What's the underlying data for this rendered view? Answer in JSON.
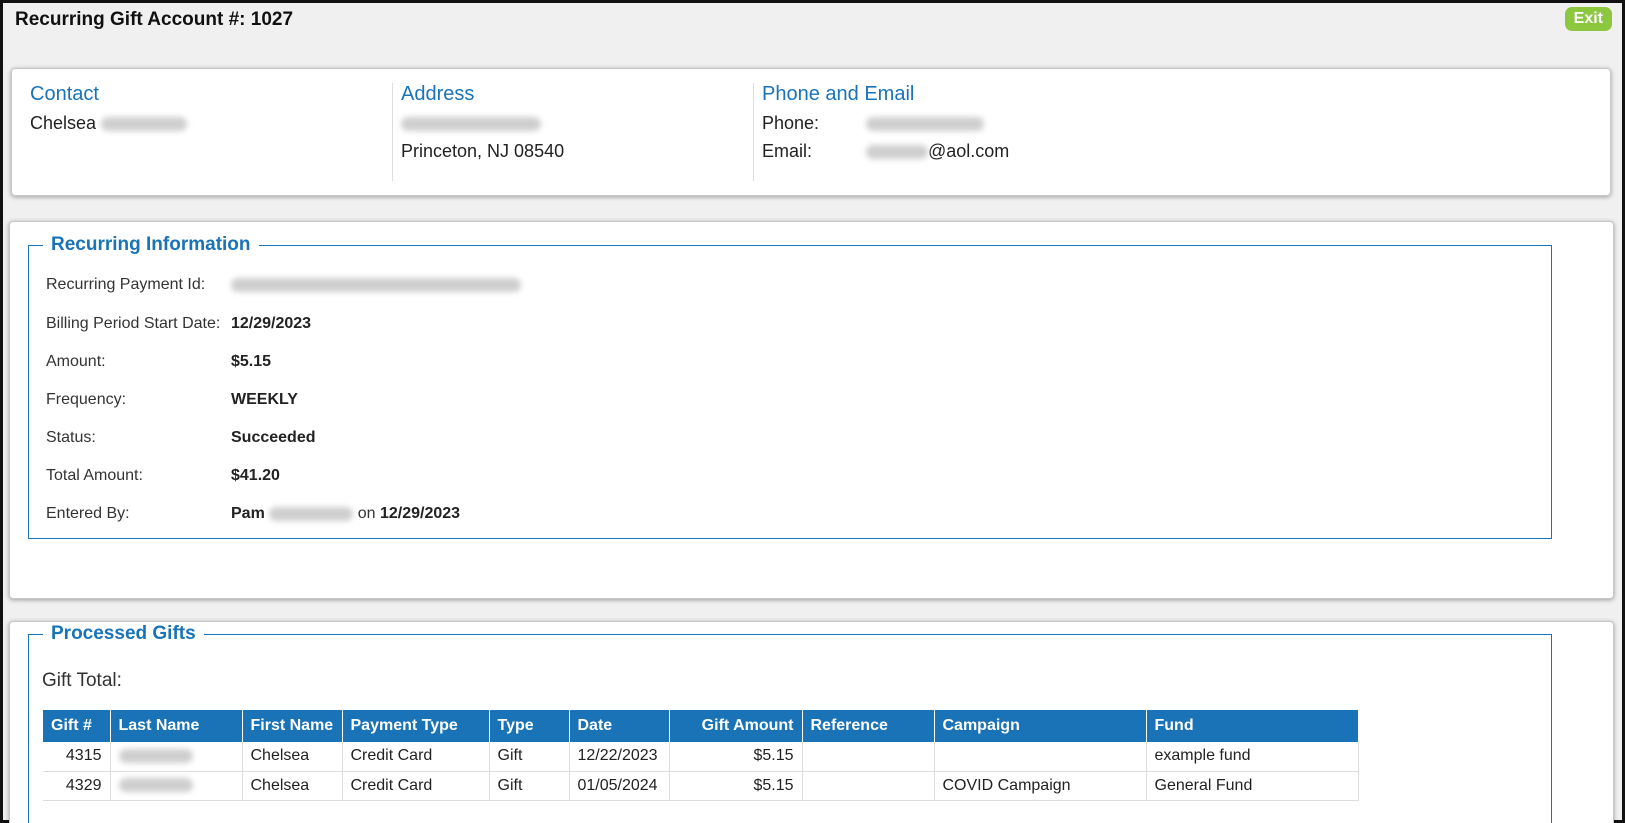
{
  "header": {
    "title": "Recurring Gift Account #: 1027",
    "exit_label": "Exit"
  },
  "contact": {
    "contact_title": "Contact",
    "contact_first": "Chelsea",
    "address_title": "Address",
    "address_city": "Princeton, NJ 08540",
    "phone_email_title": "Phone and Email",
    "phone_label": "Phone:",
    "email_label": "Email:",
    "email_suffix": "@aol.com"
  },
  "recurring": {
    "legend": "Recurring Information",
    "rows": [
      {
        "label": "Recurring Payment Id:",
        "value": ""
      },
      {
        "label": "Billing Period Start Date:",
        "value": "12/29/2023"
      },
      {
        "label": "Amount:",
        "value": "$5.15"
      },
      {
        "label": "Frequency:",
        "value": "WEEKLY"
      },
      {
        "label": "Status:",
        "value": "Succeeded"
      },
      {
        "label": "Total Amount:",
        "value": "$41.20"
      },
      {
        "label": "Entered By:",
        "value": "Pam"
      }
    ],
    "entered_on_word": "on",
    "entered_date": "12/29/2023"
  },
  "processed": {
    "legend": "Processed Gifts",
    "gift_total_label": "Gift Total:",
    "columns": [
      "Gift #",
      "Last Name",
      "First Name",
      "Payment Type",
      "Type",
      "Date",
      "Gift Amount",
      "Reference",
      "Campaign",
      "Fund"
    ],
    "rows": [
      {
        "gift_no": "4315",
        "first_name": "Chelsea",
        "payment_type": "Credit Card",
        "type": "Gift",
        "date": "12/22/2023",
        "amount": "$5.15",
        "reference": "",
        "campaign": "",
        "fund": "example fund"
      },
      {
        "gift_no": "4329",
        "first_name": "Chelsea",
        "payment_type": "Credit Card",
        "type": "Gift",
        "date": "01/05/2024",
        "amount": "$5.15",
        "reference": "",
        "campaign": "COVID Campaign",
        "fund": "General Fund"
      }
    ]
  },
  "colors": {
    "accent": "#1a73b6",
    "exit_button": "#8dc63f"
  }
}
